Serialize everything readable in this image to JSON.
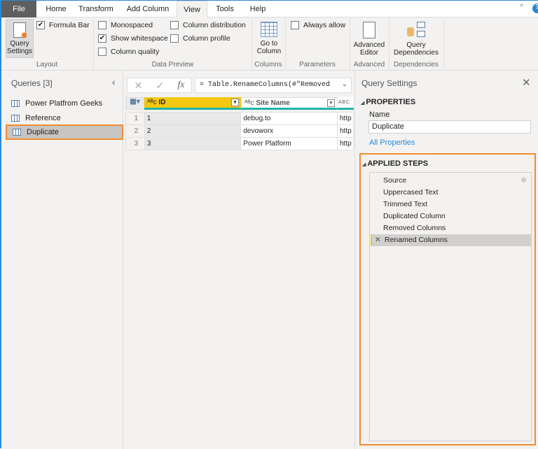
{
  "tabs": [
    "File",
    "Home",
    "Transform",
    "Add Column",
    "View",
    "Tools",
    "Help"
  ],
  "ribbon": {
    "query_settings": "Query Settings",
    "formula_bar": "Formula Bar",
    "layout": "Layout",
    "monospaced": "Monospaced",
    "show_whitespace": "Show whitespace",
    "column_quality": "Column quality",
    "column_distribution": "Column distribution",
    "column_profile": "Column profile",
    "data_preview": "Data Preview",
    "go_to_column": "Go to Column",
    "columns": "Columns",
    "always_allow": "Always allow",
    "parameters": "Parameters",
    "advanced_editor": "Advanced Editor",
    "advanced": "Advanced",
    "query_dependencies": "Query Dependencies",
    "dependencies": "Dependencies",
    "checked": {
      "formula_bar": true,
      "monospaced": false,
      "show_whitespace": true,
      "column_quality": false,
      "column_distribution": false,
      "column_profile": false,
      "always_allow": false
    }
  },
  "queries": {
    "title": "Queries [3]",
    "items": [
      "Power Platfrom Geeks",
      "Reference",
      "Duplicate"
    ],
    "selected": "Duplicate"
  },
  "formula": "= Table.RenameColumns(#\"Removed",
  "grid": {
    "columns": [
      "ID",
      "Site Name",
      "A B C"
    ],
    "rows": [
      [
        "1",
        "1",
        "debug.to",
        "http"
      ],
      [
        "2",
        "2",
        "devoworx",
        "http"
      ],
      [
        "3",
        "3",
        "Power Platform",
        "http"
      ]
    ]
  },
  "settings": {
    "title": "Query Settings",
    "properties": "PROPERTIES",
    "name_label": "Name",
    "name_value": "Duplicate",
    "all_properties": "All Properties",
    "applied_steps": "APPLIED STEPS",
    "steps": [
      "Source",
      "Uppercased Text",
      "Trimmed Text",
      "Duplicated Column",
      "Removed Columns",
      "Renamed Columns"
    ]
  },
  "colors": {
    "accent": "#f28b30",
    "header": "#f2c811",
    "teal": "#1fb5a6",
    "link": "#2b88d8"
  }
}
